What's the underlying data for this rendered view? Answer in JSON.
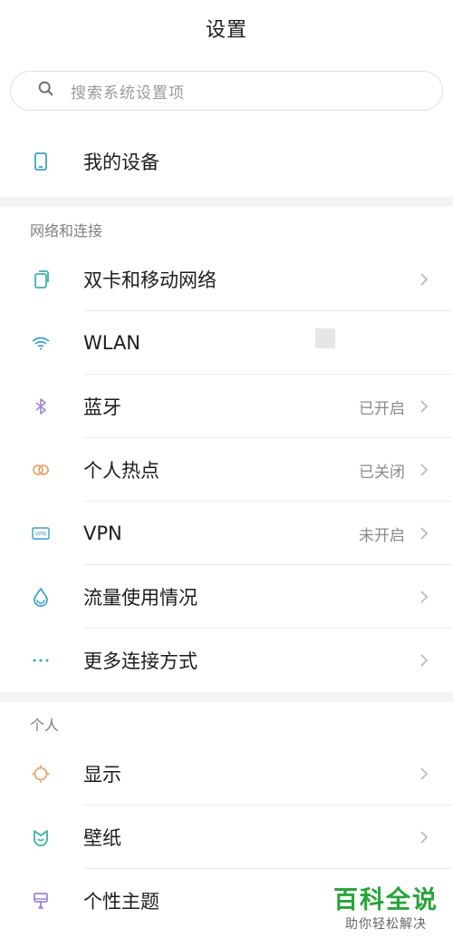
{
  "header": {
    "title": "设置"
  },
  "search": {
    "placeholder": "搜索系统设置项",
    "icon": "search-icon"
  },
  "device": {
    "label": "我的设备",
    "icon": "phone-icon",
    "color": "#3aa0c8"
  },
  "sections": [
    {
      "title": "网络和连接",
      "items": [
        {
          "label": "双卡和移动网络",
          "status": "",
          "icon": "sim-card-icon",
          "color": "#3db3a5"
        },
        {
          "label": "WLAN",
          "status": "",
          "icon": "wifi-icon",
          "color": "#3aa0c8"
        },
        {
          "label": "蓝牙",
          "status": "已开启",
          "icon": "bluetooth-icon",
          "color": "#9b86d6"
        },
        {
          "label": "个人热点",
          "status": "已关闭",
          "icon": "hotspot-icon",
          "color": "#e8a46a"
        },
        {
          "label": "VPN",
          "status": "未开启",
          "icon": "vpn-icon",
          "color": "#3aa0c8"
        },
        {
          "label": "流量使用情况",
          "status": "",
          "icon": "data-usage-icon",
          "color": "#3aa0c8"
        },
        {
          "label": "更多连接方式",
          "status": "",
          "icon": "more-icon",
          "color": "#3aa0c8"
        }
      ]
    },
    {
      "title": "个人",
      "items": [
        {
          "label": "显示",
          "status": "",
          "icon": "display-icon",
          "color": "#e8a46a"
        },
        {
          "label": "壁纸",
          "status": "",
          "icon": "wallpaper-icon",
          "color": "#3db3a5"
        },
        {
          "label": "个性主题",
          "status": "",
          "icon": "theme-icon",
          "color": "#9b86d6"
        }
      ]
    }
  ],
  "watermark": {
    "title": "百科全说",
    "subtitle": "助你轻松解决"
  }
}
